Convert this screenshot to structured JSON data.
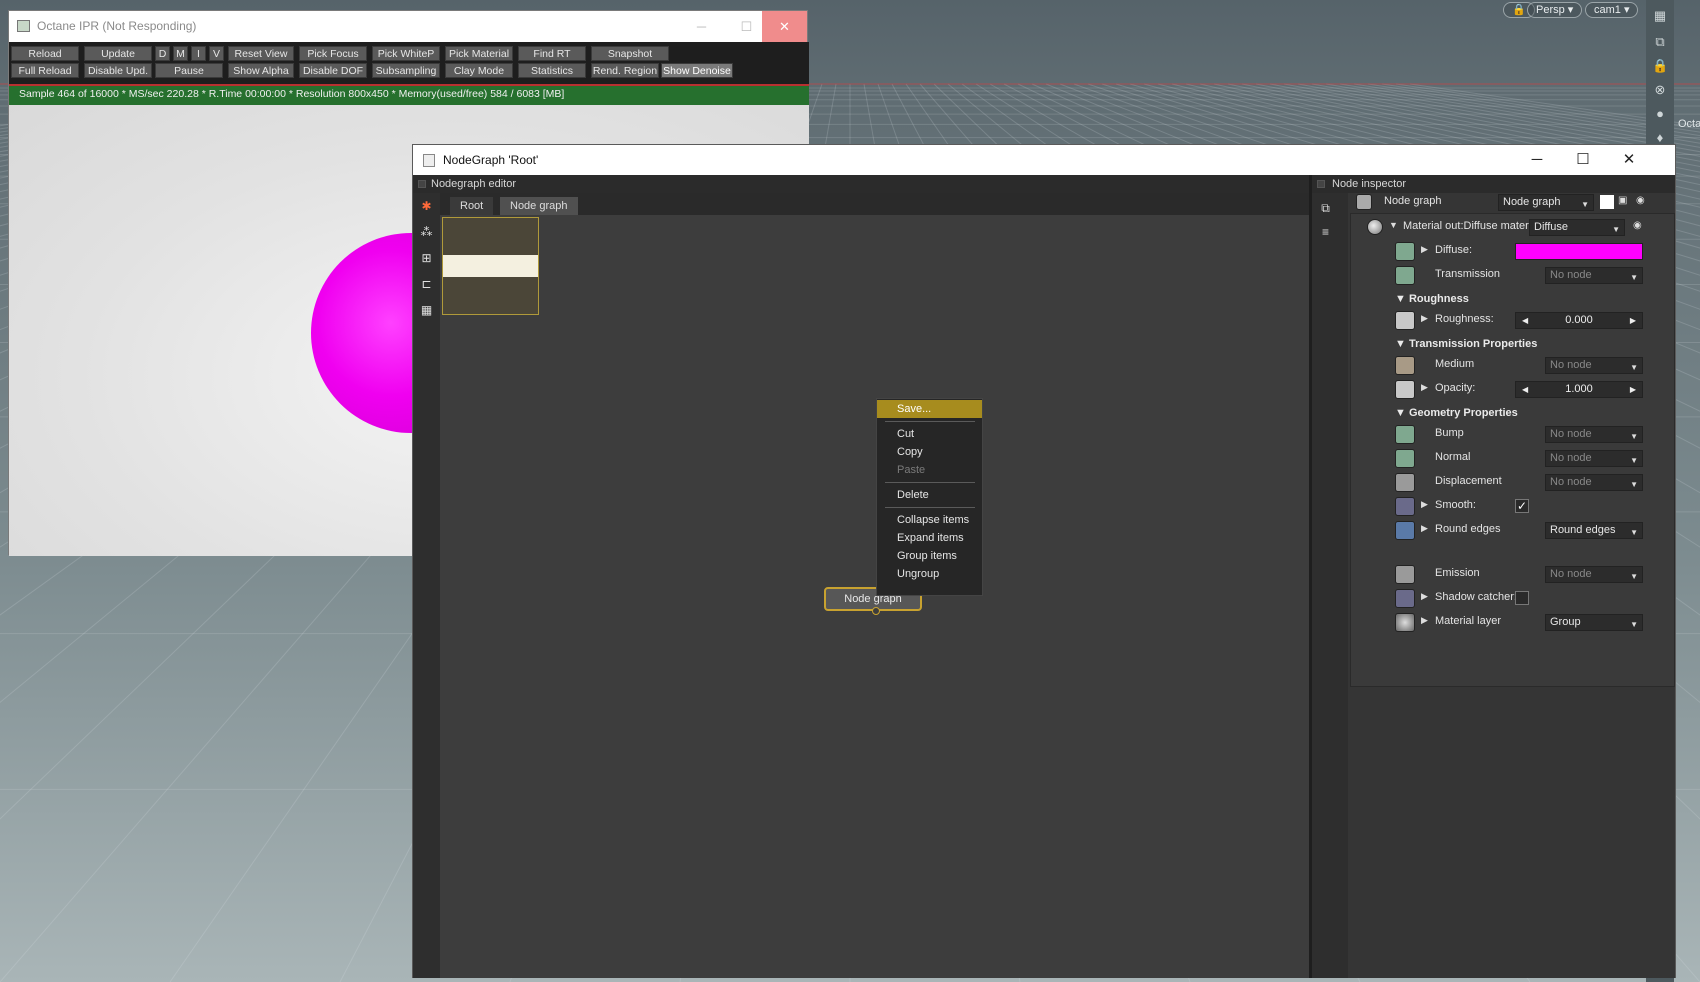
{
  "viewport": {
    "camera_mode": "Persp",
    "camera_name": "cam1",
    "side_label": "Octa",
    "right_strip_icons": [
      "paint-icon",
      "layers-icon",
      "lock-icon",
      "close-circle-icon",
      "sphere-icon",
      "light-bulb-icon"
    ]
  },
  "ipr": {
    "title": "Octane IPR (Not Responding)",
    "controls": {
      "minimize": "─",
      "maximize": "☐",
      "close": "✕"
    },
    "toolbar_row1": [
      "Reload",
      "Update",
      "D",
      "M",
      "I",
      "V",
      "Reset View",
      "Pick Focus",
      "Pick WhiteP",
      "Pick Material",
      "Find RT",
      "Snapshot"
    ],
    "toolbar_row2": [
      "Full Reload",
      "Disable Upd.",
      "Pause",
      "Show Alpha",
      "Disable DOF",
      "Subsampling",
      "Clay Mode",
      "Statistics",
      "Rend. Region",
      "Show Denoise"
    ],
    "status": "Sample 464 of 16000 * MS/sec 220.28 * R.Time 00:00:00 * Resolution 800x450 * Memory(used/free) 584 / 6083 [MB]",
    "sphere_color": "#f000f0"
  },
  "nodegraph": {
    "title": "NodeGraph 'Root'",
    "controls": {
      "minimize": "─",
      "maximize": "☐",
      "close": "✕"
    },
    "editor_header": "Nodegraph editor",
    "tabs": [
      "Root",
      "Node graph"
    ],
    "node_label": "Node graph",
    "context_menu": {
      "items": [
        "Save...",
        "Cut",
        "Copy",
        "Paste",
        "Delete",
        "Collapse items",
        "Expand items",
        "Group items",
        "Ungroup"
      ],
      "highlighted": "Save...",
      "disabled": "Paste"
    }
  },
  "inspector": {
    "header": "Node inspector",
    "node_name": "Node graph",
    "node_type": "Node graph",
    "material_out": "Material out:Diffuse materia",
    "material_type": "Diffuse",
    "rows": {
      "diffuse": {
        "label": "Diffuse:",
        "color": "#ff00ff"
      },
      "transmission": {
        "label": "Transmission",
        "value": "No node"
      },
      "roughness_section": "Roughness",
      "roughness": {
        "label": "Roughness:",
        "value": "0.000"
      },
      "transmission_props": "Transmission Properties",
      "medium": {
        "label": "Medium",
        "value": "No node"
      },
      "opacity": {
        "label": "Opacity:",
        "value": "1.000"
      },
      "geometry_props": "Geometry Properties",
      "bump": {
        "label": "Bump",
        "value": "No node"
      },
      "normal": {
        "label": "Normal",
        "value": "No node"
      },
      "displacement": {
        "label": "Displacement",
        "value": "No node"
      },
      "smooth": {
        "label": "Smooth:",
        "checked": "✓"
      },
      "round_edges": {
        "label": "Round edges",
        "value": "Round edges"
      },
      "emission": {
        "label": "Emission",
        "value": "No node"
      },
      "shadow_catcher": {
        "label": "Shadow catcher:",
        "checked": ""
      },
      "material_layer": {
        "label": "Material layer",
        "value": "Group"
      }
    }
  }
}
